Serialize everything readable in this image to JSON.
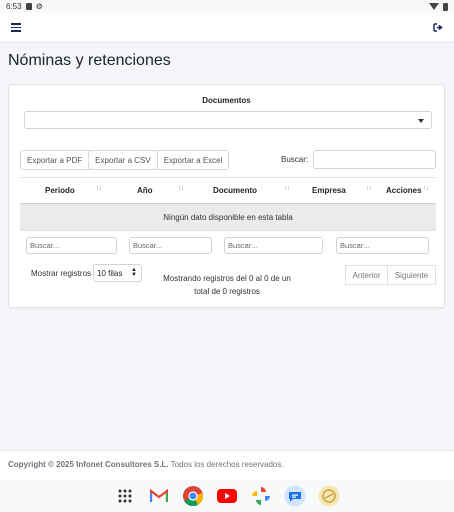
{
  "statusbar": {
    "time": "6:53"
  },
  "page": {
    "title": "Nóminas y retenciones"
  },
  "filter": {
    "documents_label": "Documentos",
    "selected": ""
  },
  "export_buttons": [
    "Exportar a PDF",
    "Exportar a CSV",
    "Exportar a Excel"
  ],
  "search": {
    "label": "Buscar:",
    "value": ""
  },
  "table": {
    "columns": [
      "Periodo",
      "Año",
      "Documento",
      "Empresa",
      "Acciones"
    ],
    "empty_message": "Ningún dato disponible en esta tabla",
    "filter_placeholder": "Buscar..."
  },
  "pagination": {
    "show_label": "Mostrar registros",
    "rows_option": "10 filas",
    "info": "Mostrando registros del 0 al 0 de un total de 0 registros",
    "prev": "Anterior",
    "next": "Siguiente"
  },
  "footer": {
    "copyright": "Copyright © 2025 Infonet Consultores S.L.",
    "rights": "Todos los derechos reservados."
  },
  "dock": [
    "apps-grid-icon",
    "gmail-icon",
    "chrome-icon",
    "youtube-icon",
    "photos-icon",
    "messages-icon",
    "app-icon"
  ],
  "colors": {
    "primary": "#1a2a5a",
    "background": "#f4f6f9",
    "empty_row": "#ebebeb"
  }
}
